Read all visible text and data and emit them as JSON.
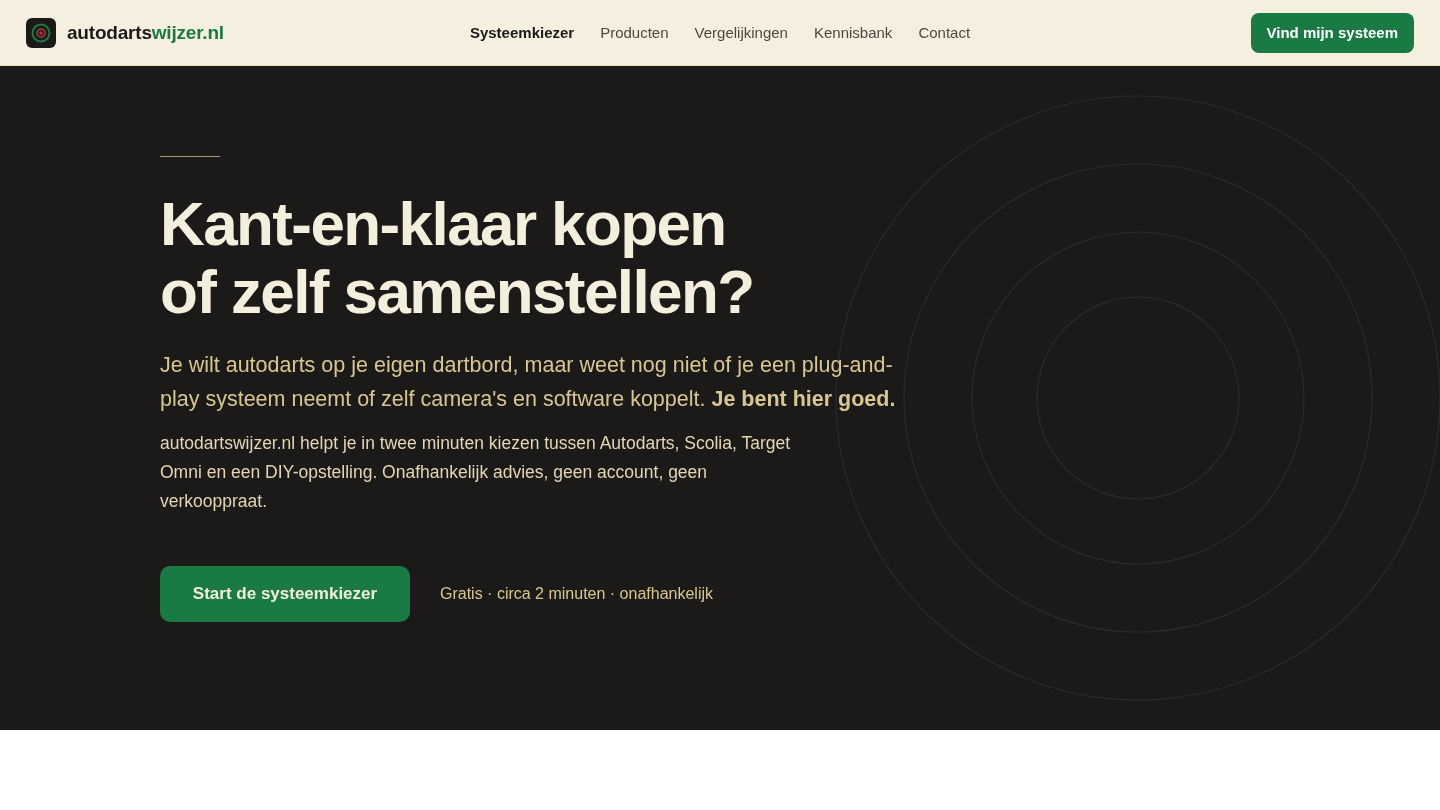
{
  "header": {
    "logo": {
      "name": "autodarts",
      "accent": "wijzer.nl"
    },
    "nav": [
      {
        "label": "Systeemkiezer",
        "selected": true
      },
      {
        "label": "Producten",
        "selected": false
      },
      {
        "label": "Vergelijkingen",
        "selected": false
      },
      {
        "label": "Kennisbank",
        "selected": false
      },
      {
        "label": "Contact",
        "selected": false
      }
    ],
    "cta": "Vind mijn systeem"
  },
  "hero": {
    "heading": [
      "Kant-en-klaar kopen",
      "of zelf samenstellen?"
    ],
    "lead": "Je wilt autodarts op je eigen dartbord, maar weet nog niet of je een plug-and-play systeem neemt of zelf camera's en software koppelt. **Je bent hier goed.**",
    "body": "autodartswijzer.nl helpt je in twee minuten kiezen tussen Autodarts, Scolia, Target Omni en een DIY-opstelling. Onafhankelijk advies, geen account, geen verkooppraat.",
    "button": "Start de systeemkiezer",
    "meta": "Gratis · circa 2 minuten · onafhankelijk"
  }
}
